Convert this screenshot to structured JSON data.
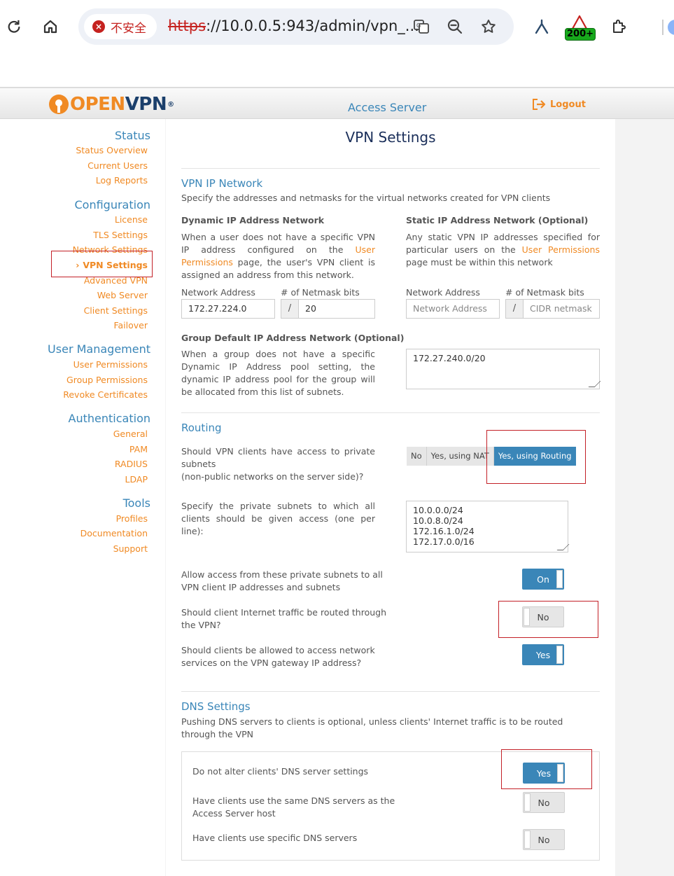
{
  "browser": {
    "security_label": "不安全",
    "url_scheme": "https",
    "url_rest": "://10.0.0.5:943/admin/vpn_...",
    "ext_badge": "200+"
  },
  "header": {
    "logo_open": "OPEN",
    "logo_vpn": "VPN",
    "logo_reg": "®",
    "title": "Access Server",
    "logout_label": "Logout"
  },
  "sidebar": {
    "status": {
      "title": "Status",
      "items": [
        "Status Overview",
        "Current Users",
        "Log Reports"
      ]
    },
    "configuration": {
      "title": "Configuration",
      "items": [
        "License",
        "TLS Settings",
        "Network Settings",
        "VPN Settings",
        "Advanced VPN",
        "Web Server",
        "Client Settings",
        "Failover"
      ]
    },
    "user_management": {
      "title": "User Management",
      "items": [
        "User Permissions",
        "Group Permissions",
        "Revoke Certificates"
      ]
    },
    "authentication": {
      "title": "Authentication",
      "items": [
        "General",
        "PAM",
        "RADIUS",
        "LDAP"
      ]
    },
    "tools": {
      "title": "Tools",
      "items": [
        "Profiles",
        "Documentation",
        "Support"
      ]
    },
    "active_marker": "›"
  },
  "main": {
    "page_title": "VPN Settings",
    "vpn_ip_network": {
      "title": "VPN IP Network",
      "desc": "Specify the addresses and netmasks for the virtual networks created for VPN clients",
      "dynamic": {
        "title": "Dynamic IP Address Network",
        "text_1": "When a user does not have a specific VPN IP address configured on the ",
        "link": "User Permissions",
        "text_2": " page, the user's VPN client is assigned an address from this network.",
        "network_label": "Network Address",
        "netmask_label": "# of Netmask bits",
        "network_value": "172.27.224.0",
        "netmask_value": "20",
        "slash": "/"
      },
      "static": {
        "title": "Static IP Address Network (Optional)",
        "text_1": "Any static VPN IP addresses specified for particular users on the ",
        "link": "User Permissions",
        "text_2": " page must be within this network",
        "network_label": "Network Address",
        "netmask_label": "# of Netmask bits",
        "network_placeholder": "Network Address",
        "netmask_placeholder": "CIDR netmask",
        "slash": "/"
      },
      "group_default": {
        "title": "Group Default IP Address Network (Optional)",
        "text": "When a group does not have a specific Dynamic IP Address pool setting, the dynamic IP address pool for the group will be allocated from this list of subnets.",
        "value": "172.27.240.0/20"
      }
    },
    "routing": {
      "title": "Routing",
      "question": "Should VPN clients have access to private subnets\n(non-public networks on the server side)?",
      "options": [
        "No",
        "Yes, using NAT",
        "Yes, using Routing"
      ],
      "selected": "Yes, using Routing",
      "subnets_label": "Specify the private subnets to which all clients should be given access (one per line):",
      "subnets_value": "10.0.0.0/24\n10.0.8.0/24\n172.16.1.0/24\n172.17.0.0/16",
      "allow_access_label": "Allow access from these private subnets to all VPN client IP addresses and subnets",
      "allow_access_value": "On",
      "internet_label": "Should client Internet traffic be routed through the VPN?",
      "internet_value": "No",
      "gateway_label": "Should clients be allowed to access network services on the VPN gateway IP address?",
      "gateway_value": "Yes"
    },
    "dns": {
      "title": "DNS Settings",
      "desc": "Pushing DNS servers to clients is optional, unless clients' Internet traffic is to be routed through the VPN",
      "rows": [
        {
          "label": "Do not alter clients' DNS server settings",
          "value": "Yes"
        },
        {
          "label": "Have clients use the same DNS servers as the Access Server host",
          "value": "No"
        },
        {
          "label": "Have clients use specific DNS servers",
          "value": "No"
        }
      ]
    }
  },
  "colors": {
    "accent_blue": "#3a86b8",
    "accent_orange": "#f08a24",
    "highlight_red": "#c32027"
  }
}
